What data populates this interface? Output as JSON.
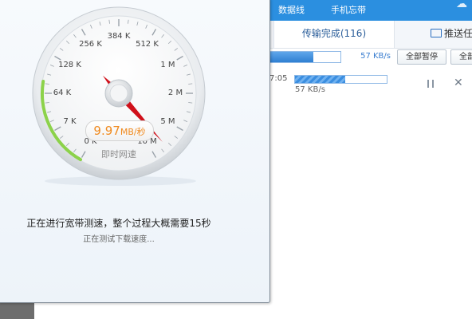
{
  "background_app": {
    "top_tabs": [
      "数据线",
      "手机忘带"
    ],
    "subtabs": {
      "completed": "传输完成(116)",
      "push": "推送任务"
    },
    "overall": {
      "progress": 0.62,
      "speed": "57 KB/s"
    },
    "buttons": {
      "pause_all": "全部暂停",
      "all": "全部"
    },
    "task": {
      "time": "7:05",
      "progress": 0.55,
      "speed": "57 KB/s"
    }
  },
  "speedtest": {
    "gauge": {
      "labels": [
        "0 K",
        "7 K",
        "64 K",
        "128 K",
        "256 K",
        "384 K",
        "512 K",
        "1 M",
        "2 M",
        "5 M",
        "10 M"
      ],
      "value": "9.97",
      "unit": "MB/秒",
      "caption": "即时网速"
    },
    "message": "正在进行宽带测速，整个过程大概需要15秒",
    "status": "正在测试下载速度..."
  },
  "colors": {
    "accent": "#2b8fe0",
    "needle": "#d0101a",
    "readout": "#f08a1e",
    "green_arc": "#8cd24a"
  }
}
